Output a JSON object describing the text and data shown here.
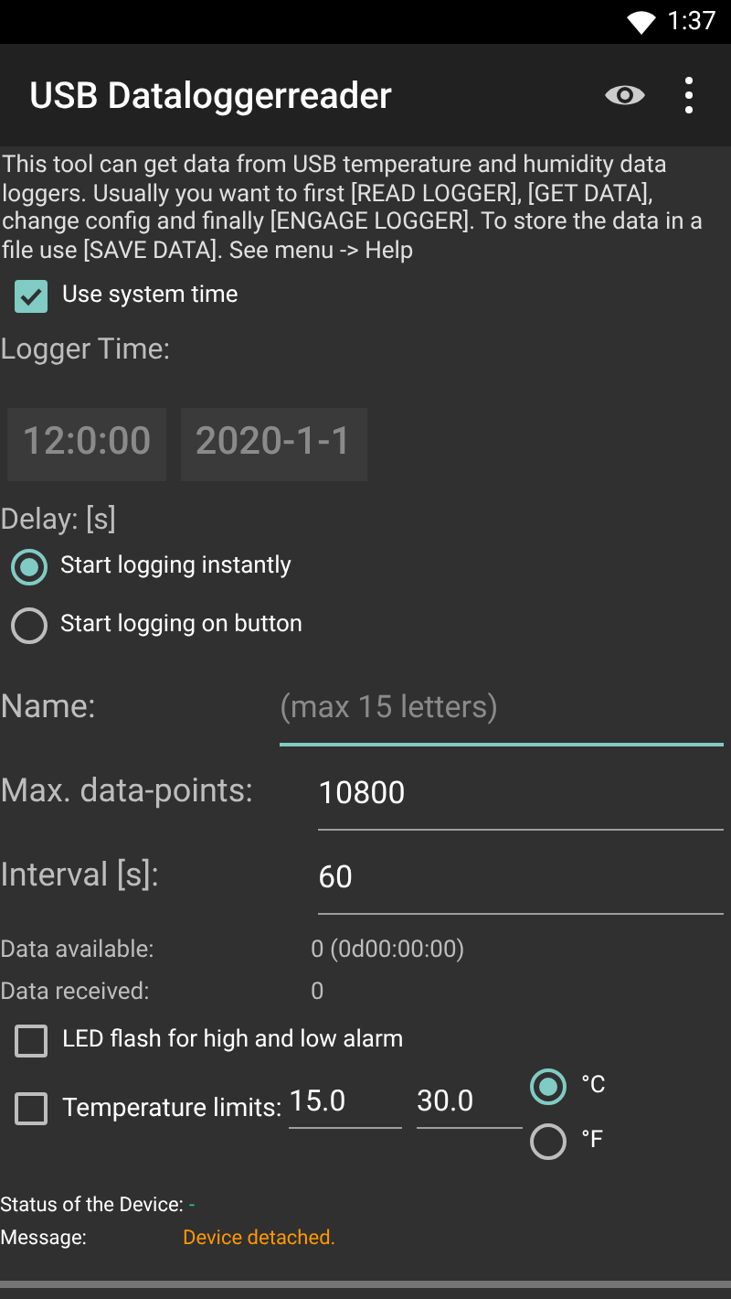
{
  "status_bar": {
    "time": "1:37"
  },
  "app_bar": {
    "title": "USB Dataloggerreader"
  },
  "intro": "This tool can get data from USB temperature and humidity data loggers. Usually you want to first [READ LOGGER], [GET DATA], change config and finally [ENGAGE LOGGER]. To store the data in a file use [SAVE DATA]. See menu -> Help",
  "use_system_time": {
    "label": "Use system time",
    "checked": true
  },
  "logger_time": {
    "label": "Logger Time:",
    "time": "12:0:00",
    "date": "2020-1-1",
    "disabled": true
  },
  "delay": {
    "label": "Delay: [s]",
    "options": [
      {
        "label": "Start logging instantly",
        "selected": true
      },
      {
        "label": "Start logging on button",
        "selected": false
      }
    ]
  },
  "fields": [
    {
      "label": "Name:",
      "placeholder": "(max 15 letters)",
      "focused": true
    },
    {
      "label": "Max. data-points:",
      "value": "10800",
      "focused": false
    },
    {
      "label": "Interval [s]:",
      "value": "60",
      "focused": false
    }
  ],
  "info": [
    {
      "label": "Data available:",
      "value": "0 (0d00:00:00)"
    },
    {
      "label": "Data received:",
      "value": "0"
    }
  ],
  "led_flash": {
    "label": "LED flash for high and low alarm",
    "checked": false
  },
  "temperature_limits": {
    "label": "Temperature limits:",
    "low": "15.0",
    "high": "30.0",
    "checked": false
  },
  "units": [
    {
      "label": "°C",
      "selected": true
    },
    {
      "label": "°F",
      "selected": false
    }
  ],
  "status": {
    "label": "Status of the Device:",
    "value": "-"
  },
  "message": {
    "label": "Message:",
    "value": "Device detached."
  }
}
